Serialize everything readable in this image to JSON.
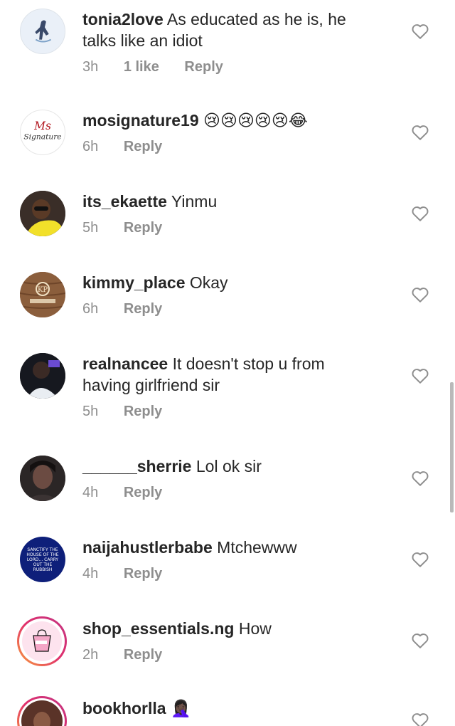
{
  "comments": [
    {
      "username": "tonia2love",
      "text": "As educated as he is, he",
      "text2": "talks like an idiot",
      "time": "3h",
      "likes": "1 like",
      "reply": "Reply",
      "avatar": "sketch"
    },
    {
      "username": "mosignature19",
      "text": "😢😢😢😢😢😂",
      "time": "6h",
      "reply": "Reply",
      "avatar": "signature-logo",
      "avatar_text": "Signature"
    },
    {
      "username": "its_ekaette",
      "text": "Yinmu",
      "time": "5h",
      "reply": "Reply",
      "avatar": "photo-yellow"
    },
    {
      "username": "kimmy_place",
      "text": "Okay",
      "time": "6h",
      "reply": "Reply",
      "avatar": "wood-logo"
    },
    {
      "username": "realnancee",
      "text": "It doesn't stop u from",
      "text2": "having girlfriend sir",
      "time": "5h",
      "reply": "Reply",
      "avatar": "photo-dark"
    },
    {
      "username": "______sherrie",
      "text": "Lol ok sir",
      "time": "4h",
      "reply": "Reply",
      "avatar": "photo-portrait"
    },
    {
      "username": "naijahustlerbabe",
      "text": "Mtchewww",
      "time": "4h",
      "reply": "Reply",
      "avatar": "blue-text",
      "avatar_text": "SANCTIFY THE HOUSE OF THE LORD... CARRY OUT THE RUBBISH"
    },
    {
      "username": "shop_essentials.ng",
      "text": "How",
      "time": "2h",
      "reply": "Reply",
      "avatar": "shop-bag"
    },
    {
      "username": "bookhorlla",
      "text": "🤦🏿‍♀️",
      "avatar": "photo-story"
    }
  ],
  "colors": {
    "text": "#262626",
    "meta": "#8e8e8e",
    "heart": "#8e8e8e"
  },
  "icons": {
    "like": "heart-outline-icon"
  }
}
